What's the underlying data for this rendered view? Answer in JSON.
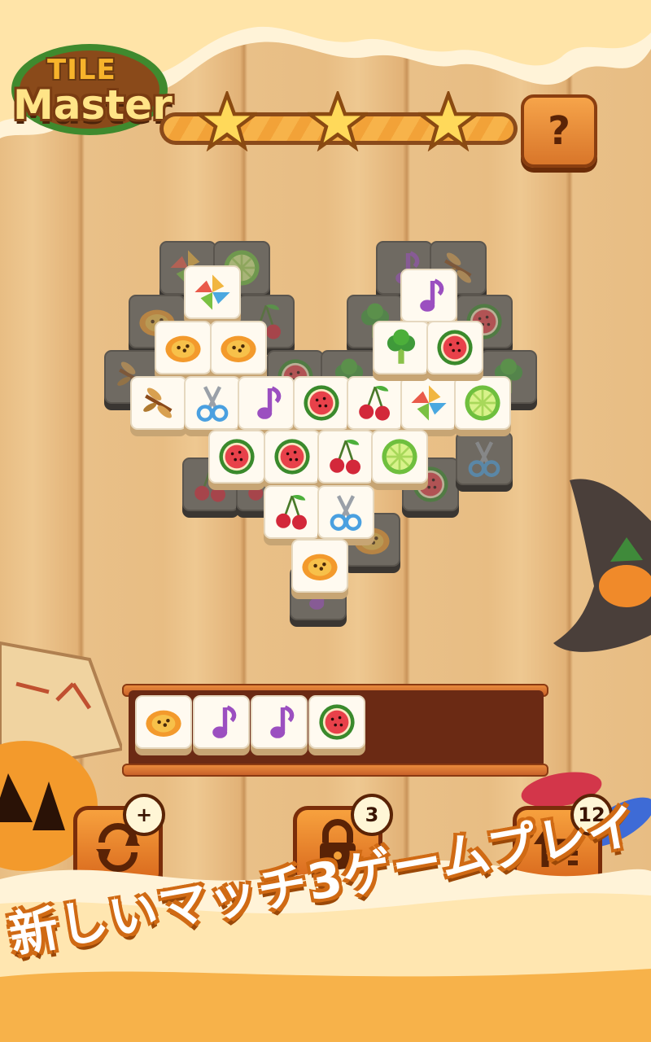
{
  "logo": {
    "line1": "TILE",
    "line2": "Master"
  },
  "progress": {
    "stars_earned": 3,
    "stars_total": 3,
    "fill_fraction": 1.0
  },
  "help_button": {
    "label": "?"
  },
  "board": {
    "tiles": [
      {
        "icon": "pinwheel",
        "state": "open"
      },
      {
        "icon": "papaya",
        "state": "open"
      },
      {
        "icon": "papaya",
        "state": "open"
      },
      {
        "icon": "dragonfly",
        "state": "open"
      },
      {
        "icon": "scissors",
        "state": "open"
      },
      {
        "icon": "music-note",
        "state": "open"
      },
      {
        "icon": "watermelon",
        "state": "open"
      },
      {
        "icon": "cherries",
        "state": "open"
      },
      {
        "icon": "pinwheel",
        "state": "open"
      },
      {
        "icon": "lime",
        "state": "open"
      },
      {
        "icon": "watermelon",
        "state": "open"
      },
      {
        "icon": "watermelon",
        "state": "open"
      },
      {
        "icon": "cherries",
        "state": "open"
      },
      {
        "icon": "lime",
        "state": "open"
      },
      {
        "icon": "cherries",
        "state": "open"
      },
      {
        "icon": "scissors",
        "state": "open"
      },
      {
        "icon": "papaya",
        "state": "open"
      },
      {
        "icon": "music-note",
        "state": "open"
      },
      {
        "icon": "broccoli",
        "state": "open"
      },
      {
        "icon": "watermelon",
        "state": "open"
      }
    ]
  },
  "tray": {
    "slots_total": 7,
    "tiles": [
      "papaya",
      "music-note",
      "music-note",
      "watermelon"
    ]
  },
  "boosters": [
    {
      "name": "shuffle",
      "badge": "+"
    },
    {
      "name": "lock",
      "badge": "3"
    },
    {
      "name": "undo",
      "badge": "12"
    }
  ],
  "tagline": "新しいマッチ3ゲームプレイ",
  "colors": {
    "wood": "#e8bd83",
    "accent": "#f39a2c",
    "tile_face": "#fffaf0",
    "tray": "#6b2a14"
  }
}
